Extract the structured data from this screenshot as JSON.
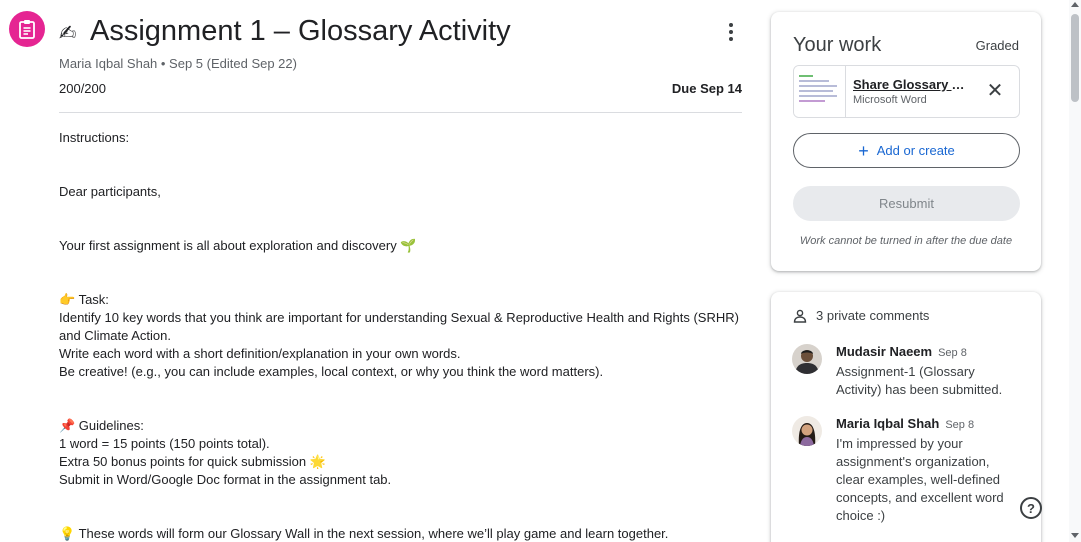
{
  "assignment": {
    "icon": "assignment-icon",
    "title_emoji": "✍",
    "title": "Assignment 1 – Glossary Activity",
    "meta": "Maria Iqbal Shah • Sep 5 (Edited Sep 22)",
    "points": "200/200",
    "due": "Due Sep 14"
  },
  "instructions": {
    "heading": "Instructions:",
    "greeting": "Dear participants,",
    "intro": "Your first assignment is all about exploration and discovery 🌱",
    "task_heading": "👉 Task:",
    "task_line1": "Identify 10 key words that you think are important for understanding Sexual & Reproductive Health and Rights (SRHR)",
    "task_line2": "and Climate Action.",
    "task_line3": "Write each word with a short definition/explanation in your own words.",
    "task_line4": "Be creative! (e.g., you can include examples, local context, or why you think the word matters).",
    "guidelines_heading": "📌 Guidelines:",
    "guideline1": "1 word = 15 points (150 points total).",
    "guideline2": "Extra 50 bonus points for quick submission 🌟",
    "guideline3": "Submit in Word/Google Doc format in the assignment tab.",
    "closing": "💡 These words will form our Glossary Wall in the next session, where we’ll play game and learn together."
  },
  "your_work": {
    "title": "Your work",
    "status": "Graded",
    "file_name": "Share Glossary Assignment",
    "file_type": "Microsoft Word",
    "add_label": "Add or create",
    "resubmit_label": "Resubmit",
    "note": "Work cannot be turned in after the due date"
  },
  "comments": {
    "header": "3 private comments",
    "items": [
      {
        "author": "Mudasir Naeem",
        "date": "Sep 8",
        "text": "Assignment-1 (Glossary Activity) has been submitted."
      },
      {
        "author": "Maria Iqbal Shah",
        "date": "Sep 8",
        "text": "I'm impressed by your assignment's organization, clear examples, well-defined concepts, and excellent word choice :)"
      }
    ]
  },
  "colors": {
    "accent": "#e52592",
    "link": "#1967d2"
  }
}
